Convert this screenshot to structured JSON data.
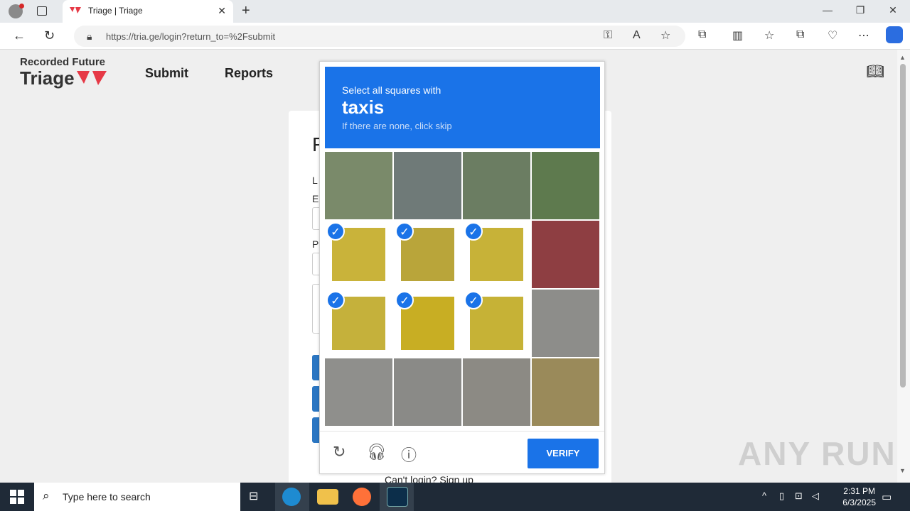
{
  "browser": {
    "tab_title": "Triage | Triage",
    "url": "https://tria.ge/login?return_to=%2Fsubmit",
    "new_tab": "+",
    "minimize": "—",
    "restore": "❐",
    "close": "✕"
  },
  "page": {
    "logo_line1": "Recorded Future",
    "logo_line2": "Triage",
    "nav": [
      "Submit",
      "Reports"
    ],
    "card_heading_partial": "F",
    "label1": "L",
    "label2": "E",
    "label3": "P",
    "footer_text": "Can't login?        Sign up"
  },
  "captcha": {
    "instruction": "Select all squares with",
    "target": "taxis",
    "hint": "If there are none, click skip",
    "verify_label": "VERIFY",
    "check_glyph": "✓",
    "tiles": [
      {
        "selected": false,
        "color": "#7a8a6a"
      },
      {
        "selected": false,
        "color": "#6f7a78"
      },
      {
        "selected": false,
        "color": "#6b7d62"
      },
      {
        "selected": false,
        "color": "#5e7a4e"
      },
      {
        "selected": true,
        "color": "#c9b33a"
      },
      {
        "selected": true,
        "color": "#b9a53a"
      },
      {
        "selected": true,
        "color": "#c7b238"
      },
      {
        "selected": false,
        "color": "#8e3e42"
      },
      {
        "selected": true,
        "color": "#c5b13b"
      },
      {
        "selected": true,
        "color": "#c8ae23"
      },
      {
        "selected": true,
        "color": "#c6b236"
      },
      {
        "selected": false,
        "color": "#8d8d8a"
      },
      {
        "selected": false,
        "color": "#8f8f8c"
      },
      {
        "selected": false,
        "color": "#8a8a87"
      },
      {
        "selected": false,
        "color": "#8c8a84"
      },
      {
        "selected": false,
        "color": "#9a8a5a"
      }
    ]
  },
  "taskbar": {
    "search_placeholder": "Type here to search",
    "time": "2:31 PM",
    "date": "6/3/2025"
  },
  "watermark": "ANY RUN"
}
